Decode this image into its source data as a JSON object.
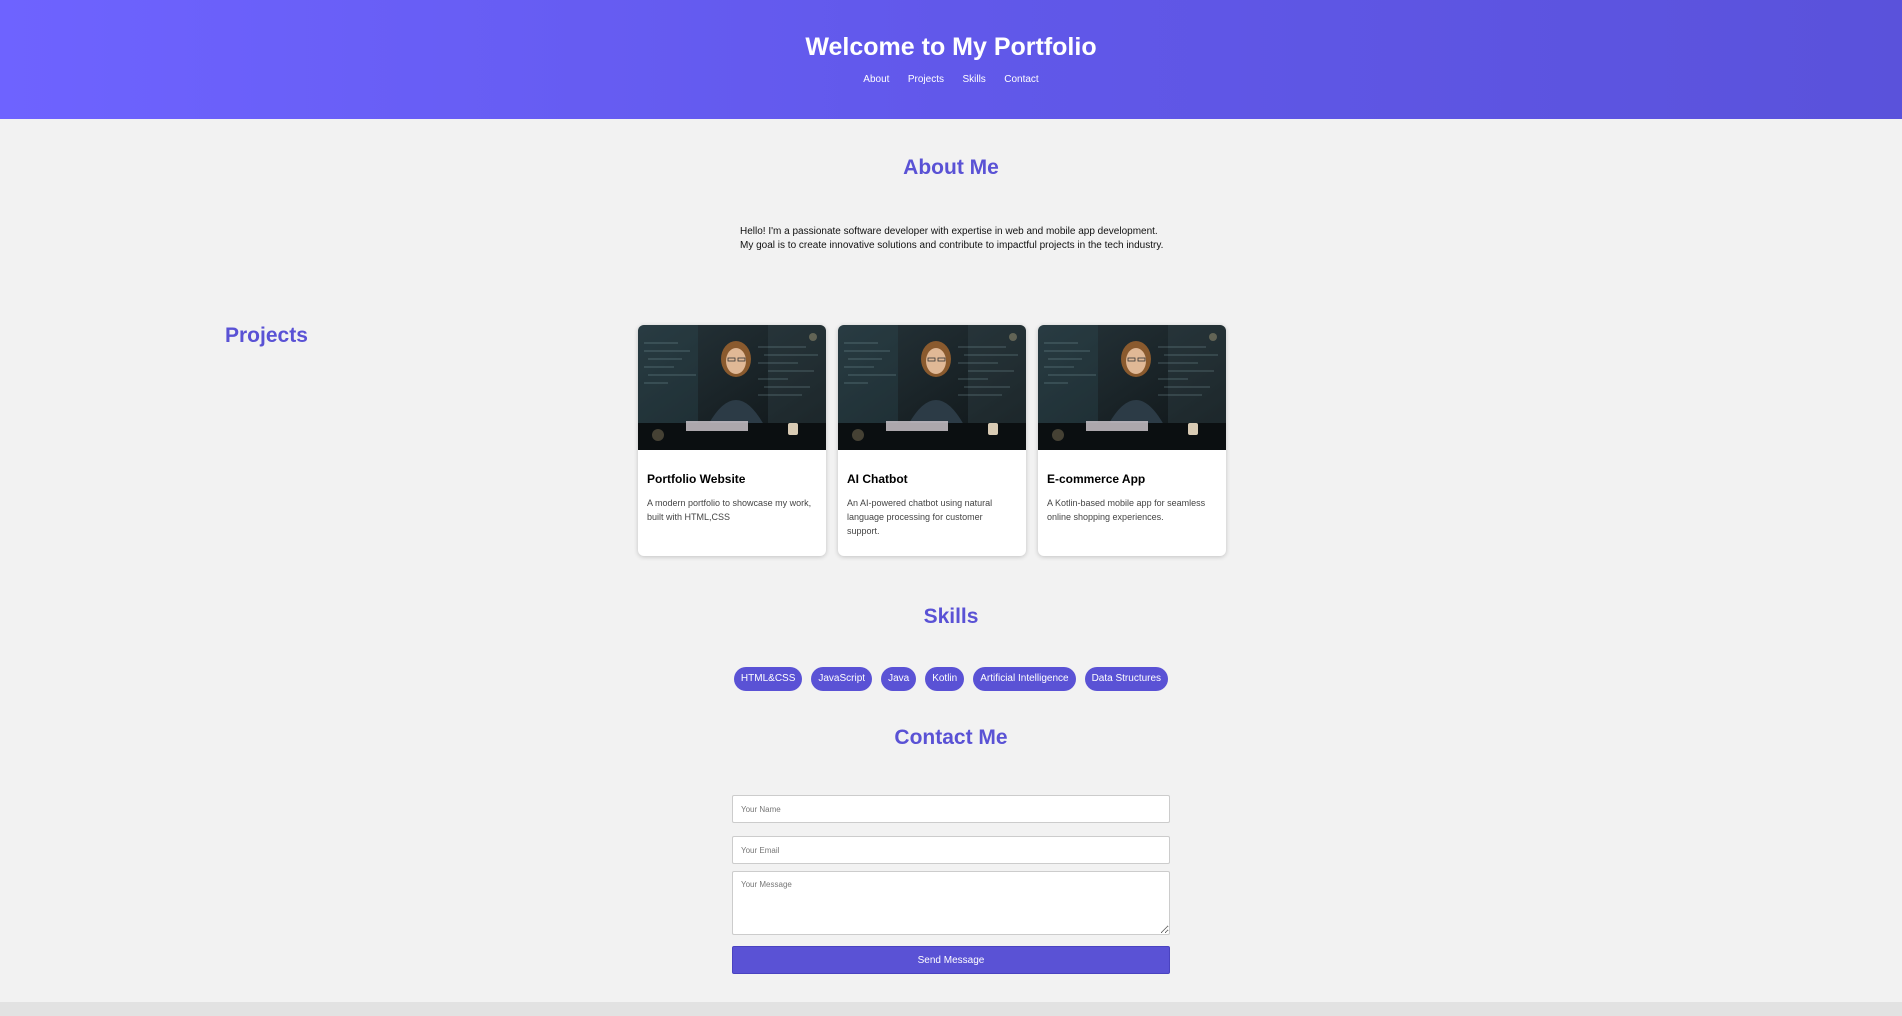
{
  "header": {
    "title": "Welcome to My Portfolio",
    "nav": [
      "About",
      "Projects",
      "Skills",
      "Contact"
    ]
  },
  "about": {
    "title": "About Me",
    "text": "Hello! I'm a passionate software developer with expertise in web and mobile app development. My goal is to create innovative solutions and contribute to impactful projects in the tech industry."
  },
  "projects": {
    "title": "Projects",
    "items": [
      {
        "title": "Portfolio Website",
        "description": "A modern portfolio to showcase my work, built with HTML,CSS"
      },
      {
        "title": "AI Chatbot",
        "description": "An AI-powered chatbot using natural language processing for customer support."
      },
      {
        "title": "E-commerce App",
        "description": "A Kotlin-based mobile app for seamless online shopping experiences."
      }
    ]
  },
  "skills": {
    "title": "Skills",
    "items": [
      "HTML&CSS",
      "JavaScript",
      "Java",
      "Kotlin",
      "Artificial Intelligence",
      "Data Structures"
    ]
  },
  "contact": {
    "title": "Contact Me",
    "name_placeholder": "Your Name",
    "email_placeholder": "Your Email",
    "message_placeholder": "Your Message",
    "submit_label": "Send Message"
  },
  "colors": {
    "accent": "#5a52d5",
    "header_gradient_start": "#6e63ff",
    "header_gradient_end": "#5a52db",
    "background": "#f2f2f2"
  }
}
